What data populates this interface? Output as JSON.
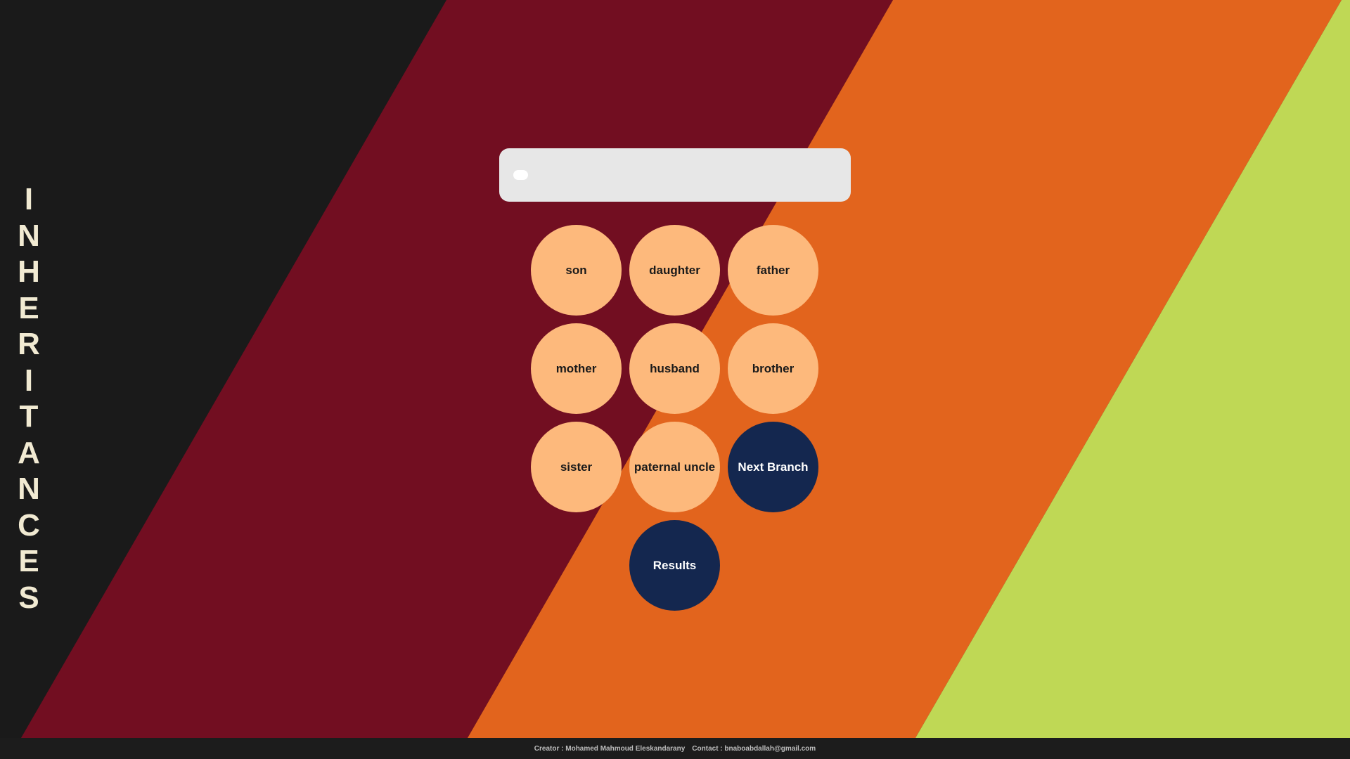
{
  "app": {
    "title_letters": [
      "I",
      "N",
      "H",
      "E",
      "R",
      "I",
      "T",
      "A",
      "N",
      "C",
      "E",
      "S"
    ]
  },
  "colors": {
    "background": "#1a1a1a",
    "band_crimson": "#720e21",
    "band_orange": "#e2641d",
    "band_lime": "#bfd855",
    "button_peach": "#fdb97c",
    "button_navy": "#14274f",
    "search_panel": "#e7e7e7",
    "title_text": "#f1ead2"
  },
  "search": {
    "value": ""
  },
  "heirs": [
    {
      "label": "son"
    },
    {
      "label": "daughter"
    },
    {
      "label": "father"
    },
    {
      "label": "mother"
    },
    {
      "label": "husband"
    },
    {
      "label": "brother"
    },
    {
      "label": "sister"
    },
    {
      "label": "paternal uncle"
    }
  ],
  "actions": {
    "next_branch": "Next Branch",
    "results": "Results"
  },
  "footer": {
    "creator": "Creator : Mohamed Mahmoud Eleskandarany",
    "contact": "Contact : bnaboabdallah@gmail.com"
  }
}
